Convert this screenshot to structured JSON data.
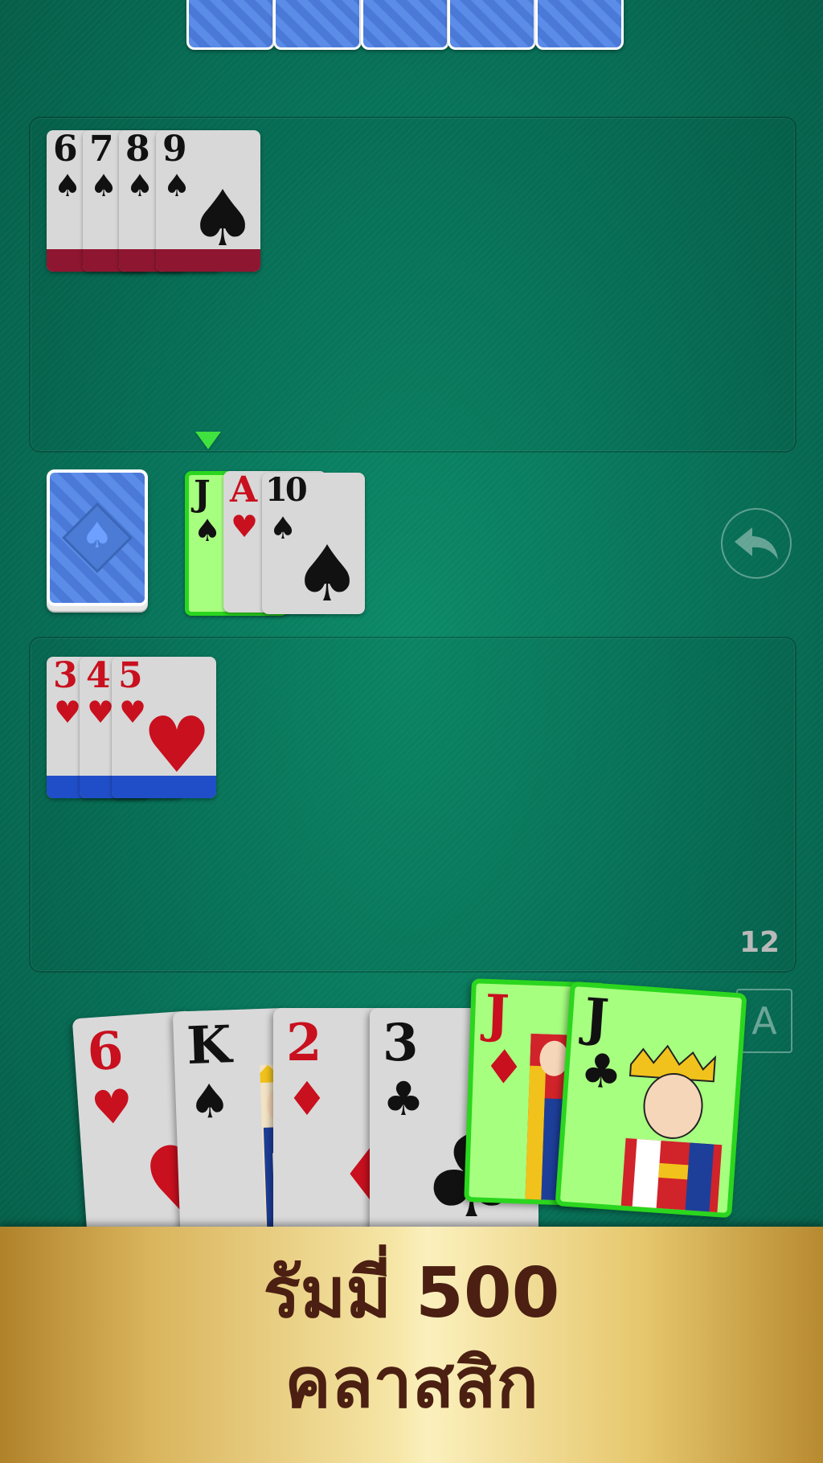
{
  "opponent_hand": {
    "card_count": 5
  },
  "meld_top": {
    "cards": [
      {
        "rank": "6",
        "suit": "♠",
        "color": "black"
      },
      {
        "rank": "7",
        "suit": "♠",
        "color": "black"
      },
      {
        "rank": "8",
        "suit": "♠",
        "color": "black"
      },
      {
        "rank": "9",
        "suit": "♠",
        "color": "black"
      }
    ],
    "stripe_color": "#8e1630"
  },
  "discard_pile": [
    {
      "rank": "J",
      "suit": "♠",
      "color": "black",
      "selected": true
    },
    {
      "rank": "A",
      "suit": "♥",
      "color": "red"
    },
    {
      "rank": "10",
      "suit": "♠",
      "color": "black"
    }
  ],
  "meld_bottom": {
    "cards": [
      {
        "rank": "3",
        "suit": "♥",
        "color": "red"
      },
      {
        "rank": "4",
        "suit": "♥",
        "color": "red"
      },
      {
        "rank": "5",
        "suit": "♥",
        "color": "red"
      }
    ],
    "stripe_color": "#1f4ec8"
  },
  "status": {
    "count": "12"
  },
  "buttons": {
    "sort_label": "A",
    "undo_icon": "undo-arrow"
  },
  "player_hand": [
    {
      "rank": "6",
      "suit": "♥",
      "color": "red"
    },
    {
      "rank": "K",
      "suit": "♠",
      "color": "black"
    },
    {
      "rank": "2",
      "suit": "♦",
      "color": "red"
    },
    {
      "rank": "3",
      "suit": "♣",
      "color": "black"
    },
    {
      "rank": "J",
      "suit": "♦",
      "color": "red",
      "selected": true
    },
    {
      "rank": "J",
      "suit": "♣",
      "color": "black",
      "selected": true
    }
  ],
  "banner": {
    "line1": "รัมมี่ 500",
    "line2": "คลาสสิก"
  },
  "colors": {
    "felt": "#08745a",
    "selected_card": "#a7ff80",
    "selected_border": "#2bd61e"
  }
}
